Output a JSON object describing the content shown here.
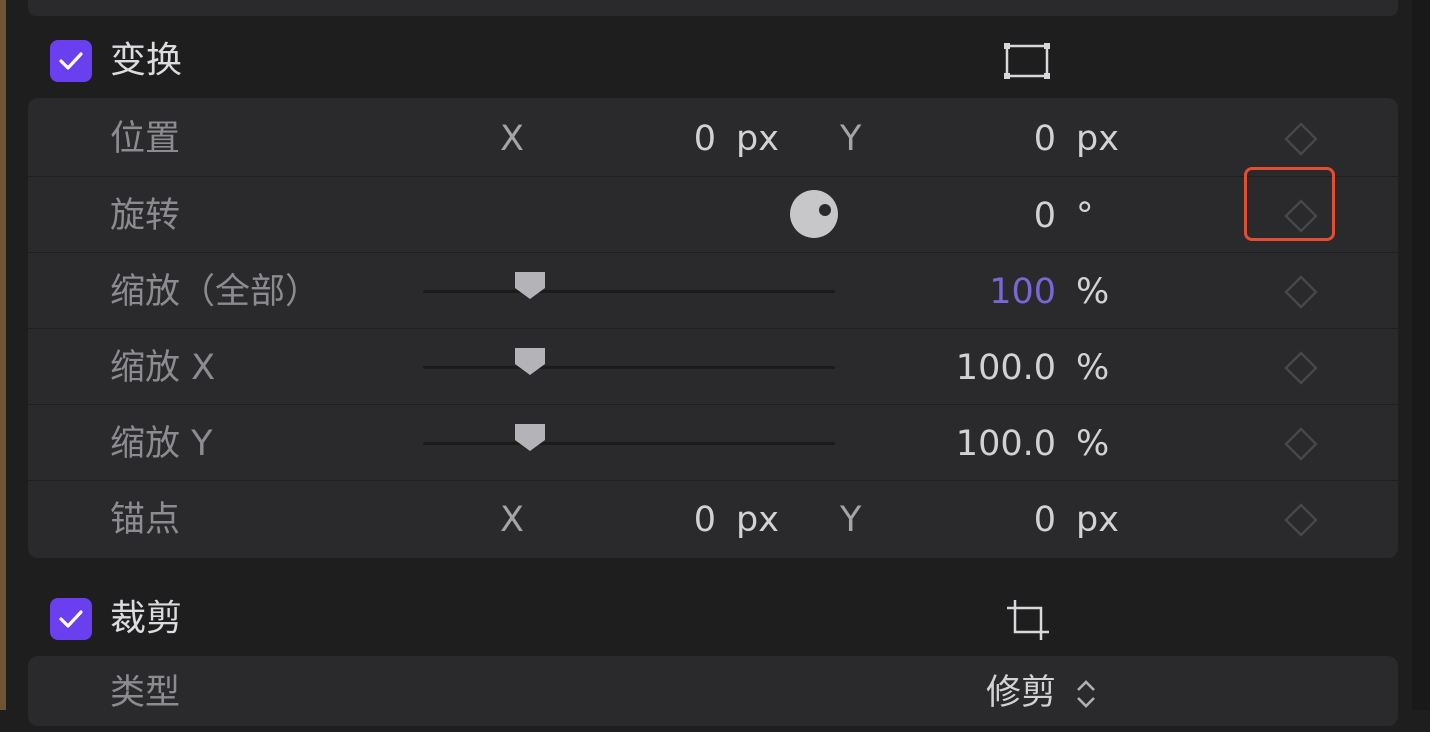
{
  "colors": {
    "accent": "#6a3ff0",
    "accent_text": "#7b66d8",
    "highlight": "#e04e35"
  },
  "transform": {
    "title": "变换",
    "enabled": true,
    "icon": "transform-bounds-icon",
    "rows": {
      "position": {
        "label": "位置",
        "x_axis": "X",
        "x_value": "0",
        "x_unit": "px",
        "y_axis": "Y",
        "y_value": "0",
        "y_unit": "px"
      },
      "rotation": {
        "label": "旋转",
        "value": "0",
        "unit": "°"
      },
      "scale_all": {
        "label": "缩放（全部）",
        "value": "100",
        "unit": "%",
        "slider_fraction": 0.26
      },
      "scale_x": {
        "label": "缩放 X",
        "value": "100.0",
        "unit": "%",
        "slider_fraction": 0.26
      },
      "scale_y": {
        "label": "缩放 Y",
        "value": "100.0",
        "unit": "%",
        "slider_fraction": 0.26
      },
      "anchor": {
        "label": "锚点",
        "x_axis": "X",
        "x_value": "0",
        "x_unit": "px",
        "y_axis": "Y",
        "y_value": "0",
        "y_unit": "px"
      }
    }
  },
  "crop": {
    "title": "裁剪",
    "enabled": true,
    "icon": "crop-icon",
    "rows": {
      "type": {
        "label": "类型",
        "value": "修剪"
      }
    }
  }
}
